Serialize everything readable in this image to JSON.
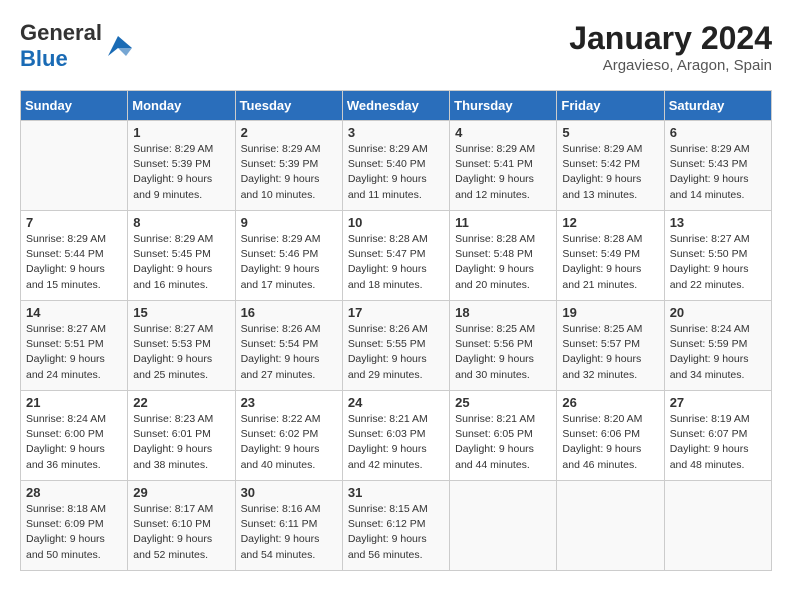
{
  "logo": {
    "general": "General",
    "blue": "Blue"
  },
  "title": {
    "month": "January 2024",
    "location": "Argavieso, Aragon, Spain"
  },
  "headers": [
    "Sunday",
    "Monday",
    "Tuesday",
    "Wednesday",
    "Thursday",
    "Friday",
    "Saturday"
  ],
  "weeks": [
    [
      {
        "day": "",
        "sunrise": "",
        "sunset": "",
        "daylight": ""
      },
      {
        "day": "1",
        "sunrise": "Sunrise: 8:29 AM",
        "sunset": "Sunset: 5:39 PM",
        "daylight": "Daylight: 9 hours and 9 minutes."
      },
      {
        "day": "2",
        "sunrise": "Sunrise: 8:29 AM",
        "sunset": "Sunset: 5:39 PM",
        "daylight": "Daylight: 9 hours and 10 minutes."
      },
      {
        "day": "3",
        "sunrise": "Sunrise: 8:29 AM",
        "sunset": "Sunset: 5:40 PM",
        "daylight": "Daylight: 9 hours and 11 minutes."
      },
      {
        "day": "4",
        "sunrise": "Sunrise: 8:29 AM",
        "sunset": "Sunset: 5:41 PM",
        "daylight": "Daylight: 9 hours and 12 minutes."
      },
      {
        "day": "5",
        "sunrise": "Sunrise: 8:29 AM",
        "sunset": "Sunset: 5:42 PM",
        "daylight": "Daylight: 9 hours and 13 minutes."
      },
      {
        "day": "6",
        "sunrise": "Sunrise: 8:29 AM",
        "sunset": "Sunset: 5:43 PM",
        "daylight": "Daylight: 9 hours and 14 minutes."
      }
    ],
    [
      {
        "day": "7",
        "sunrise": "Sunrise: 8:29 AM",
        "sunset": "Sunset: 5:44 PM",
        "daylight": "Daylight: 9 hours and 15 minutes."
      },
      {
        "day": "8",
        "sunrise": "Sunrise: 8:29 AM",
        "sunset": "Sunset: 5:45 PM",
        "daylight": "Daylight: 9 hours and 16 minutes."
      },
      {
        "day": "9",
        "sunrise": "Sunrise: 8:29 AM",
        "sunset": "Sunset: 5:46 PM",
        "daylight": "Daylight: 9 hours and 17 minutes."
      },
      {
        "day": "10",
        "sunrise": "Sunrise: 8:28 AM",
        "sunset": "Sunset: 5:47 PM",
        "daylight": "Daylight: 9 hours and 18 minutes."
      },
      {
        "day": "11",
        "sunrise": "Sunrise: 8:28 AM",
        "sunset": "Sunset: 5:48 PM",
        "daylight": "Daylight: 9 hours and 20 minutes."
      },
      {
        "day": "12",
        "sunrise": "Sunrise: 8:28 AM",
        "sunset": "Sunset: 5:49 PM",
        "daylight": "Daylight: 9 hours and 21 minutes."
      },
      {
        "day": "13",
        "sunrise": "Sunrise: 8:27 AM",
        "sunset": "Sunset: 5:50 PM",
        "daylight": "Daylight: 9 hours and 22 minutes."
      }
    ],
    [
      {
        "day": "14",
        "sunrise": "Sunrise: 8:27 AM",
        "sunset": "Sunset: 5:51 PM",
        "daylight": "Daylight: 9 hours and 24 minutes."
      },
      {
        "day": "15",
        "sunrise": "Sunrise: 8:27 AM",
        "sunset": "Sunset: 5:53 PM",
        "daylight": "Daylight: 9 hours and 25 minutes."
      },
      {
        "day": "16",
        "sunrise": "Sunrise: 8:26 AM",
        "sunset": "Sunset: 5:54 PM",
        "daylight": "Daylight: 9 hours and 27 minutes."
      },
      {
        "day": "17",
        "sunrise": "Sunrise: 8:26 AM",
        "sunset": "Sunset: 5:55 PM",
        "daylight": "Daylight: 9 hours and 29 minutes."
      },
      {
        "day": "18",
        "sunrise": "Sunrise: 8:25 AM",
        "sunset": "Sunset: 5:56 PM",
        "daylight": "Daylight: 9 hours and 30 minutes."
      },
      {
        "day": "19",
        "sunrise": "Sunrise: 8:25 AM",
        "sunset": "Sunset: 5:57 PM",
        "daylight": "Daylight: 9 hours and 32 minutes."
      },
      {
        "day": "20",
        "sunrise": "Sunrise: 8:24 AM",
        "sunset": "Sunset: 5:59 PM",
        "daylight": "Daylight: 9 hours and 34 minutes."
      }
    ],
    [
      {
        "day": "21",
        "sunrise": "Sunrise: 8:24 AM",
        "sunset": "Sunset: 6:00 PM",
        "daylight": "Daylight: 9 hours and 36 minutes."
      },
      {
        "day": "22",
        "sunrise": "Sunrise: 8:23 AM",
        "sunset": "Sunset: 6:01 PM",
        "daylight": "Daylight: 9 hours and 38 minutes."
      },
      {
        "day": "23",
        "sunrise": "Sunrise: 8:22 AM",
        "sunset": "Sunset: 6:02 PM",
        "daylight": "Daylight: 9 hours and 40 minutes."
      },
      {
        "day": "24",
        "sunrise": "Sunrise: 8:21 AM",
        "sunset": "Sunset: 6:03 PM",
        "daylight": "Daylight: 9 hours and 42 minutes."
      },
      {
        "day": "25",
        "sunrise": "Sunrise: 8:21 AM",
        "sunset": "Sunset: 6:05 PM",
        "daylight": "Daylight: 9 hours and 44 minutes."
      },
      {
        "day": "26",
        "sunrise": "Sunrise: 8:20 AM",
        "sunset": "Sunset: 6:06 PM",
        "daylight": "Daylight: 9 hours and 46 minutes."
      },
      {
        "day": "27",
        "sunrise": "Sunrise: 8:19 AM",
        "sunset": "Sunset: 6:07 PM",
        "daylight": "Daylight: 9 hours and 48 minutes."
      }
    ],
    [
      {
        "day": "28",
        "sunrise": "Sunrise: 8:18 AM",
        "sunset": "Sunset: 6:09 PM",
        "daylight": "Daylight: 9 hours and 50 minutes."
      },
      {
        "day": "29",
        "sunrise": "Sunrise: 8:17 AM",
        "sunset": "Sunset: 6:10 PM",
        "daylight": "Daylight: 9 hours and 52 minutes."
      },
      {
        "day": "30",
        "sunrise": "Sunrise: 8:16 AM",
        "sunset": "Sunset: 6:11 PM",
        "daylight": "Daylight: 9 hours and 54 minutes."
      },
      {
        "day": "31",
        "sunrise": "Sunrise: 8:15 AM",
        "sunset": "Sunset: 6:12 PM",
        "daylight": "Daylight: 9 hours and 56 minutes."
      },
      {
        "day": "",
        "sunrise": "",
        "sunset": "",
        "daylight": ""
      },
      {
        "day": "",
        "sunrise": "",
        "sunset": "",
        "daylight": ""
      },
      {
        "day": "",
        "sunrise": "",
        "sunset": "",
        "daylight": ""
      }
    ]
  ]
}
